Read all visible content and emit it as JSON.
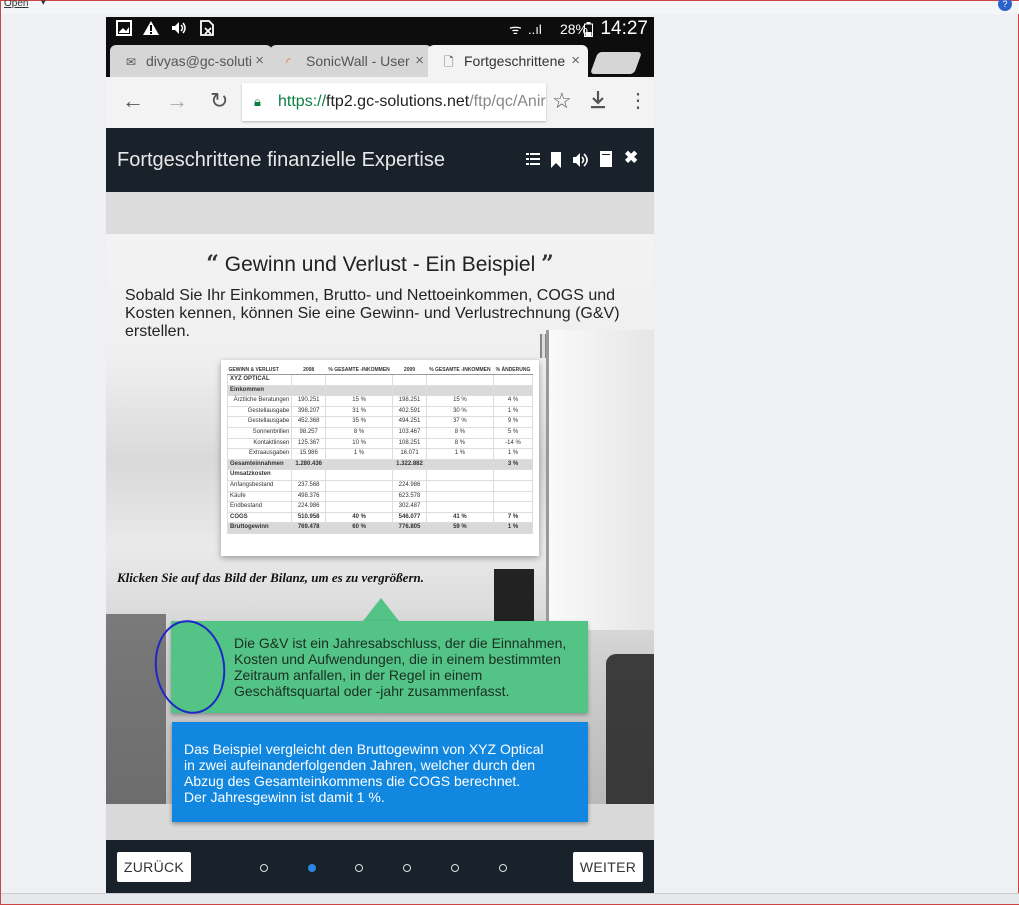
{
  "host": {
    "open_label": "Open",
    "open_caret": "▾",
    "help_icon": "?"
  },
  "statusbar": {
    "icons": [
      "image-icon",
      "warning-icon",
      "volume-icon",
      "sim-icon"
    ],
    "wifi": "ᯤ",
    "signal": "..ıl",
    "battery_text": "28%",
    "time": "14:27"
  },
  "tabs": [
    {
      "label": "divyas@gc-soluti",
      "icon": "mail-icon",
      "close": "×",
      "active": false
    },
    {
      "label": "SonicWall - User",
      "icon": "sonicwall-icon",
      "close": "×",
      "active": false
    },
    {
      "label": "Fortgeschrittene",
      "icon": "page-icon",
      "close": "×",
      "active": true
    }
  ],
  "omnibar": {
    "url_scheme": "https://",
    "url_host": "ftp2.gc-solutions.net",
    "url_path": "/ftp/qc/Anir"
  },
  "course": {
    "title": "Fortgeschrittene finanzielle Expertise",
    "header_icons": [
      "list-icon",
      "bookmark-icon",
      "audio-icon",
      "notes-icon",
      "close-icon"
    ]
  },
  "slide": {
    "heading": "Gewinn und Verlust - Ein Beispiel",
    "open_quote": "“",
    "close_quote": "”",
    "intro": "Sobald Sie Ihr Einkommen, Brutto- und Nettoeinkommen, COGS und Kosten kennen, können Sie eine Gewinn- und Verlustrechnung (G&V) erstellen.",
    "enlarge_hint": "Klicken Sie auf das Bild der Bilanz, um es zu vergrößern.",
    "green_callout": "Die G&V ist ein Jahresabschluss, der die Einnahmen, Kosten und Aufwendungen, die in einem bestimmten Zeitraum anfallen, in der Regel in einem Geschäftsquartal oder -jahr zusammenfasst.",
    "blue_callout": "Das Beispiel vergleicht den Bruttogewinn von XYZ Optical in zwei aufeinanderfolgenden Jahren, welcher durch den Abzug des Gesamteinkommens die COGS berechnet. Der Jahresgewinn ist damit 1 %."
  },
  "statement": {
    "headers": [
      "GEWINN & VERLUST",
      "2008",
      "% GESAMTE -INKOMMEN",
      "2009",
      "% GESAMTE -INKOMMEN",
      "% ÄNDERUNG"
    ],
    "rows": [
      {
        "kind": "bold",
        "cells": [
          "XYZ OPTICAL",
          "",
          "",
          "",
          "",
          ""
        ]
      },
      {
        "kind": "section",
        "cells": [
          "Einkommen",
          "",
          "",
          "",
          "",
          ""
        ]
      },
      {
        "kind": "indent",
        "cells": [
          "Ärztliche Beratungen",
          "190.251",
          "15 %",
          "198.251",
          "15 %",
          "4 %"
        ]
      },
      {
        "kind": "indent",
        "cells": [
          "Gestellausgabe",
          "398.207",
          "31 %",
          "402.591",
          "30 %",
          "1 %"
        ]
      },
      {
        "kind": "indent",
        "cells": [
          "Gestellausgabe",
          "452.368",
          "35 %",
          "494.251",
          "37 %",
          "9 %"
        ]
      },
      {
        "kind": "indent",
        "cells": [
          "Sonnenbrillen",
          "98.257",
          "8 %",
          "103.467",
          "8 %",
          "5 %"
        ]
      },
      {
        "kind": "indent",
        "cells": [
          "Kontaktlinsen",
          "125.367",
          "10 %",
          "108.251",
          "8 %",
          "-14 %"
        ]
      },
      {
        "kind": "indent",
        "cells": [
          "Extraausgaben",
          "15.986",
          "1 %",
          "16.071",
          "1 %",
          "1 %"
        ]
      },
      {
        "kind": "total",
        "cells": [
          "Gesamteinnahmen",
          "1.280.436",
          "",
          "1.322.882",
          "",
          "3 %"
        ]
      },
      {
        "kind": "bold",
        "cells": [
          "Umsatzkosten",
          "",
          "",
          "",
          "",
          ""
        ]
      },
      {
        "kind": "plain",
        "cells": [
          "Anfangsbestand",
          "237.568",
          "",
          "224.986",
          "",
          ""
        ]
      },
      {
        "kind": "plain",
        "cells": [
          "Käufe",
          "498.376",
          "",
          "623.578",
          "",
          ""
        ]
      },
      {
        "kind": "plain",
        "cells": [
          "Endbestand",
          "224.986",
          "",
          "302.487",
          "",
          ""
        ]
      },
      {
        "kind": "bold",
        "cells": [
          "COGS",
          "510.958",
          "40 %",
          "546.077",
          "41 %",
          "7 %"
        ]
      },
      {
        "kind": "total",
        "cells": [
          "Bruttogewinn",
          "769.478",
          "60 %",
          "776.805",
          "59 %",
          "1 %"
        ]
      }
    ]
  },
  "footer": {
    "back_label": "ZURÜCK",
    "next_label": "WEITER",
    "page_count": 6,
    "active_page": 2
  },
  "colors": {
    "header_bg": "#19222b",
    "green_callout": "#53c486",
    "blue_callout": "#1187e0",
    "active_dot": "#2b86e5"
  }
}
